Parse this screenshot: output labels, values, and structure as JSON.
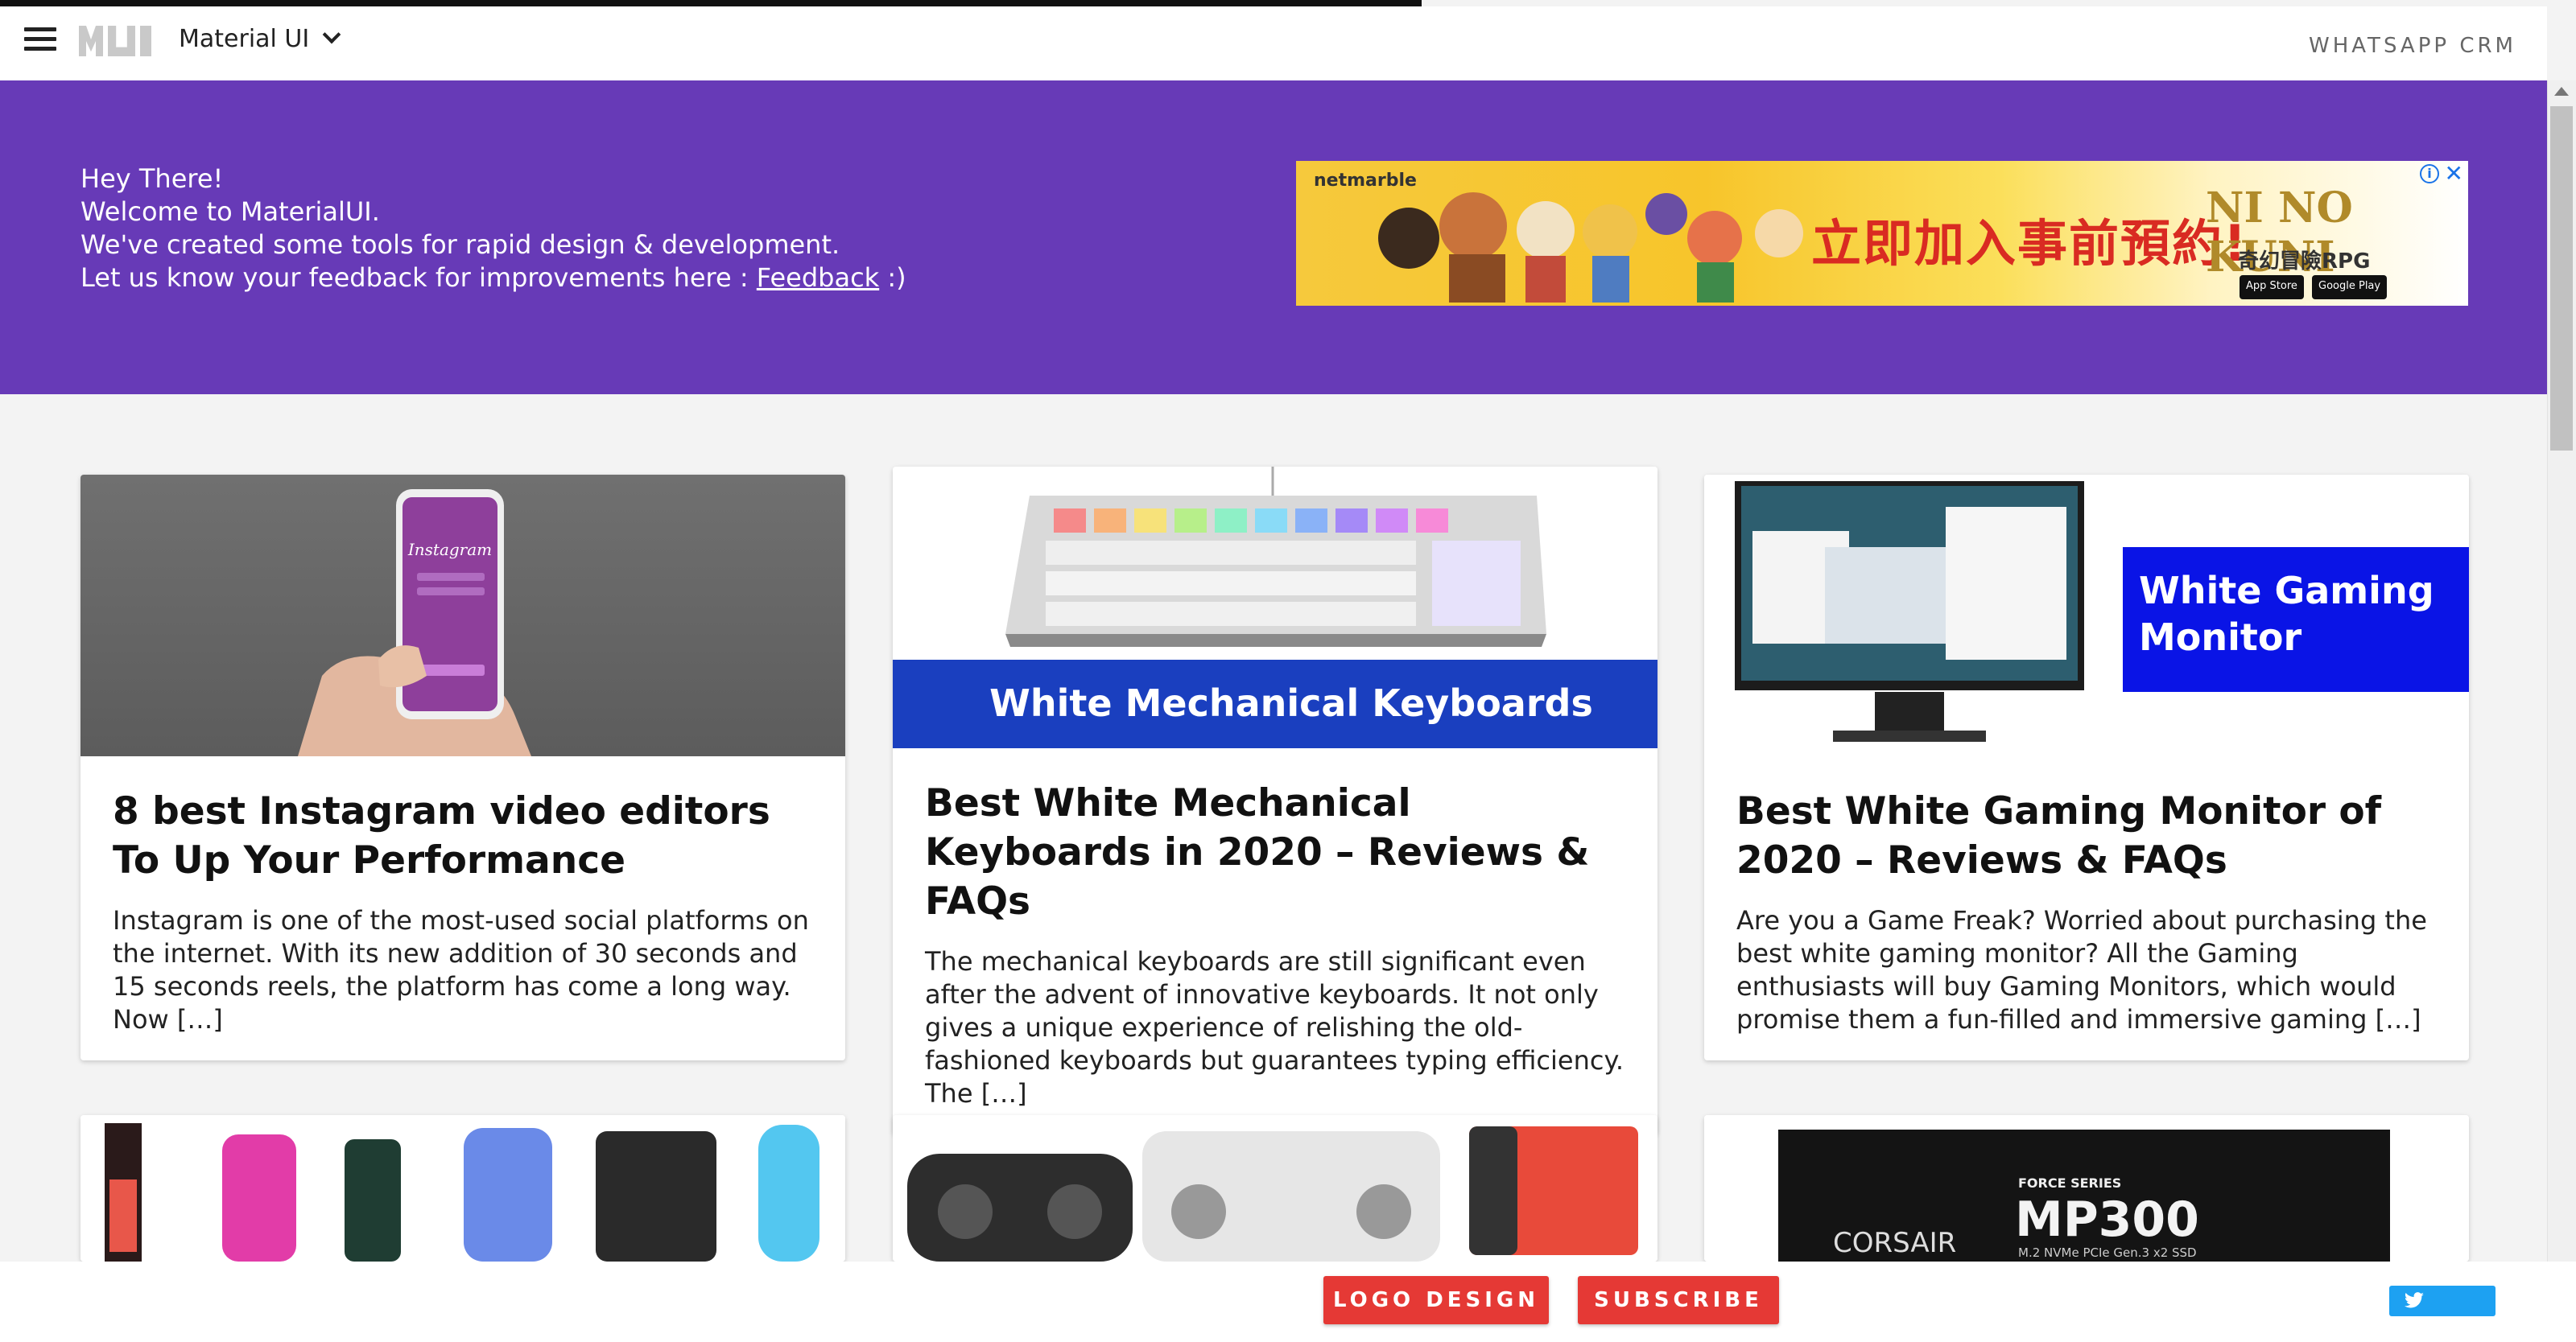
{
  "header": {
    "brand_label": "Material UI",
    "right_link": "WHATSAPP CRM"
  },
  "hero": {
    "line1": "Hey There!",
    "line2": "Welcome to MaterialUI.",
    "line3": "We've created some tools for rapid design & development.",
    "line4_prefix": "Let us know your feedback for improvements here : ",
    "feedback_link": "Feedback",
    "line4_suffix": " :)"
  },
  "ad": {
    "brand": "netmarble",
    "headline": "立即加入事前預約!",
    "logo": "NI NO KUNI",
    "subtitle": "奇幻冒險RPG",
    "store1": "App Store",
    "store2": "Google Play"
  },
  "cards": [
    {
      "title": "8 best Instagram video editors To Up Your Performance",
      "excerpt": "Instagram is one of the most-used social platforms on the internet. With its new addition of 30 seconds and 15 seconds reels, the platform has come a long way. Now […]",
      "image_text": "Instagram"
    },
    {
      "title": "Best White Mechanical Keyboards in 2020 – Reviews & FAQs",
      "excerpt": "The mechanical keyboards are still significant even after the advent of innovative keyboards. It not only gives a unique experience of relishing the old-fashioned keyboards but guarantees typing efficiency. The […]",
      "image_text": "White Mechanical Keyboards"
    },
    {
      "title": "Best White Gaming Monitor of 2020 – Reviews & FAQs",
      "excerpt": "Are you a Game Freak? Worried about purchasing the best white gaming monitor? All the Gaming enthusiasts will buy Gaming Monitors, which would promise them a fun-filled and immersive gaming […]",
      "image_text": "White Gaming Monitor"
    },
    {
      "image_text": ""
    },
    {
      "image_text": ""
    },
    {
      "image_text": "CORSAIR",
      "image_series": "FORCE SERIES",
      "image_model": "MP300",
      "image_spec": "M.2 NVMe PCIe Gen.3 x2 SSD"
    }
  ],
  "bottom": {
    "logo_design_label": "LOGO DESIGN",
    "subscribe_label": "SUBSCRIBE"
  },
  "colors": {
    "hero_bg": "#673ab7",
    "cta_red": "#e53935",
    "twitter": "#1da1f2",
    "banner_blue": "#1a3fbf",
    "monitor_blue": "#0a14e6"
  }
}
